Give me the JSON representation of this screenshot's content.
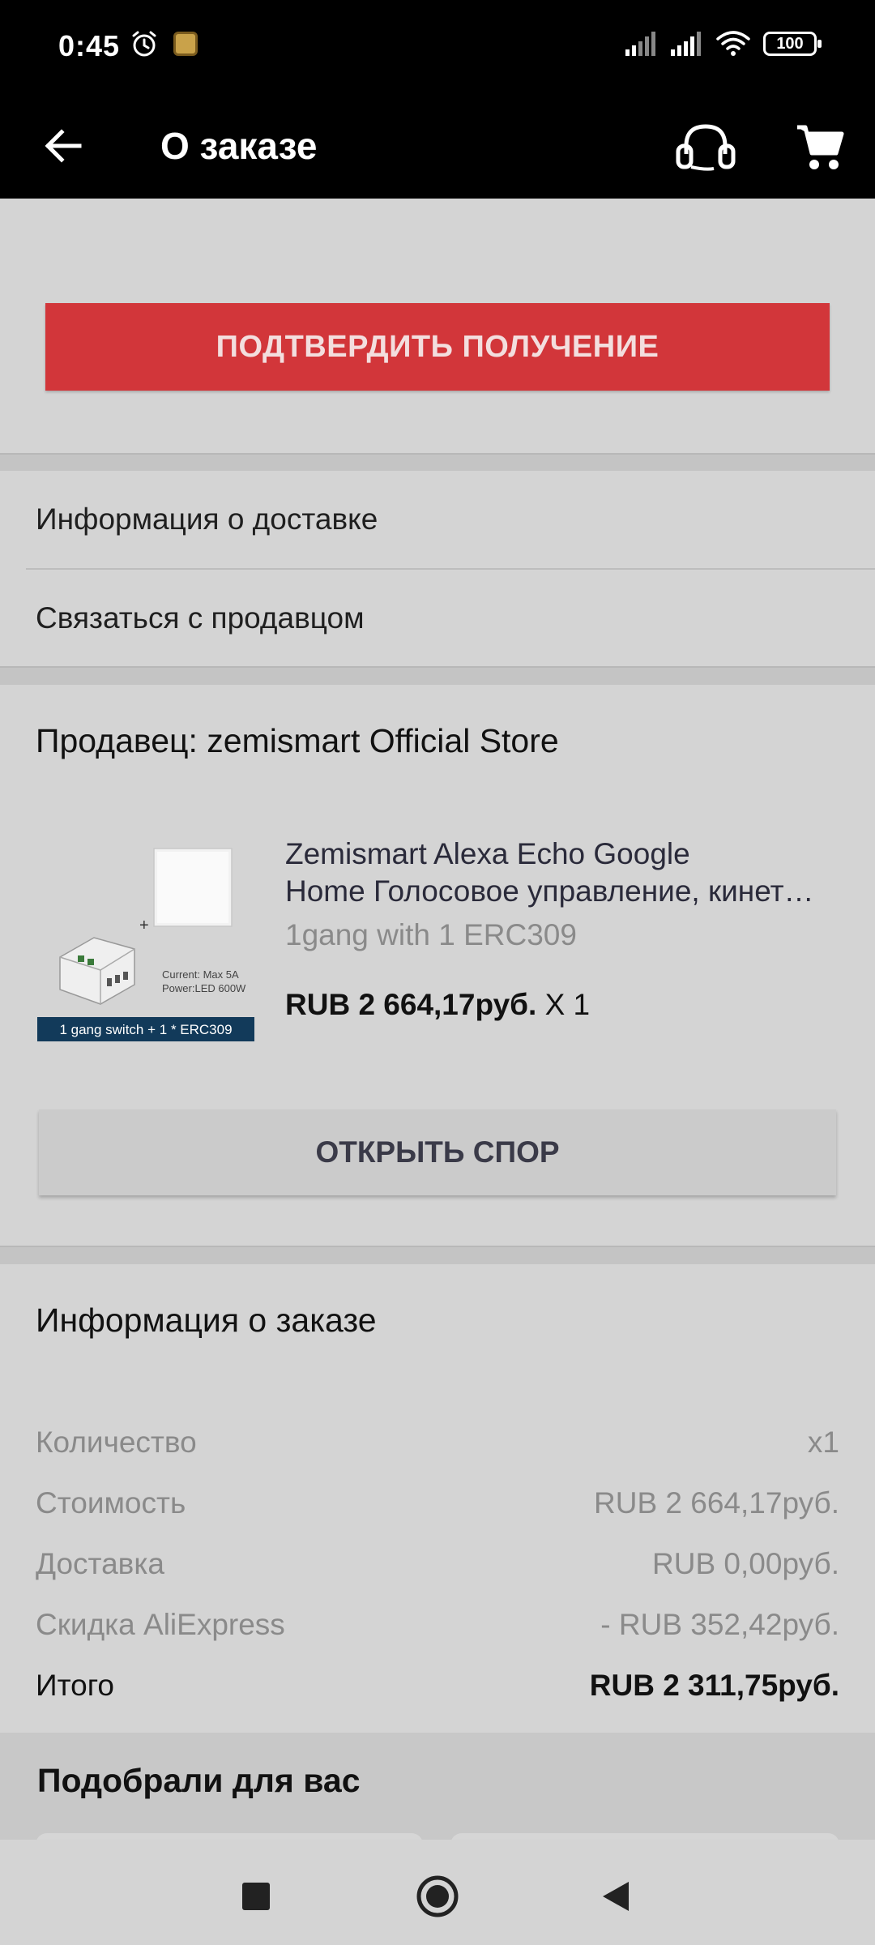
{
  "status_bar": {
    "time": "0:45",
    "battery": "100",
    "icons": [
      "alarm-icon",
      "app-notification-icon",
      "signal-icon",
      "signal-icon",
      "wifi-icon",
      "battery-icon"
    ]
  },
  "app_bar": {
    "title": "О заказе",
    "icons": [
      "back-arrow-icon",
      "headset-icon",
      "cart-icon"
    ]
  },
  "actions": {
    "confirm_label": "ПОДТВЕРДИТЬ ПОЛУЧЕНИЕ",
    "confirm_color": "#d2363a"
  },
  "links": {
    "delivery_info": "Информация о доставке",
    "contact_seller": "Связаться с продавцом"
  },
  "seller": {
    "label": "Продавец: zemismart Official Store",
    "product": {
      "title_line1": "Zemismart Alexa Echo Google",
      "title_line2": "Home Голосовое управление, кинет…",
      "variant": "1gang with 1 ERC309",
      "price": "RUB 2 664,17руб.",
      "quantity": "X 1",
      "image_caption": "1 gang switch + 1 * ERC309",
      "image_spec_1": "Current: Max 5A",
      "image_spec_2": "Power:LED 600W",
      "image_plus": "+"
    },
    "dispute_label": "ОТКРЫТЬ СПОР"
  },
  "order_info": {
    "title": "Информация о заказе",
    "rows": [
      {
        "label": "Количество",
        "value": "x1"
      },
      {
        "label": "Стоимость",
        "value": "RUB 2 664,17руб."
      },
      {
        "label": "Доставка",
        "value": "RUB 0,00руб."
      },
      {
        "label": "Скидка AliExpress",
        "value": "- RUB 352,42руб."
      },
      {
        "label": "Итого",
        "value": "RUB 2 311,75руб."
      }
    ]
  },
  "recommendations": {
    "title": "Подобрали для вас"
  },
  "nav_bar": {
    "icons": [
      "recents-square-icon",
      "home-circle-icon",
      "back-triangle-icon"
    ]
  }
}
